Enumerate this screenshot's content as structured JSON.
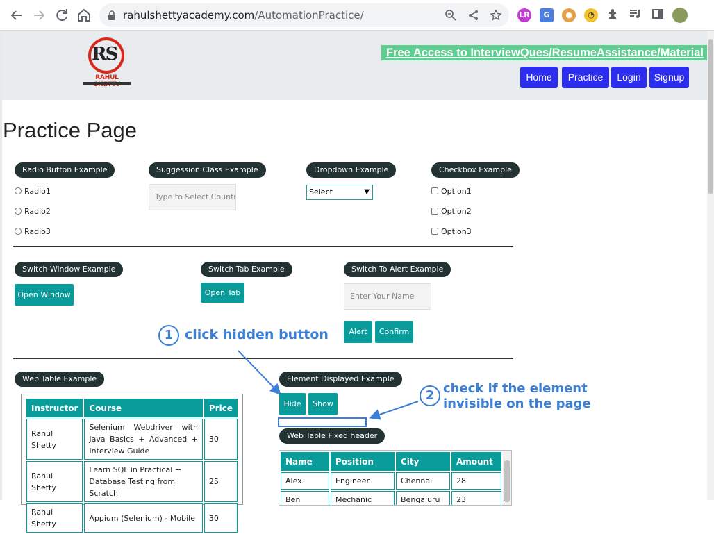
{
  "browser": {
    "url_domain": "rahulshettyacademy.com",
    "url_path": "/AutomationPractice/",
    "icons": [
      "back-icon",
      "forward-icon",
      "reload-icon",
      "home-icon",
      "lock-icon",
      "zoom-icon",
      "share-icon",
      "star-icon",
      "extensions-icon"
    ]
  },
  "header": {
    "logo_initials": "RS",
    "logo_name": "RAHUL SHETTY",
    "free_access_link": "Free Access to InterviewQues/ResumeAssistance/Material",
    "nav": [
      "Home",
      "Practice",
      "Login",
      "Signup"
    ]
  },
  "page_title": "Practice Page",
  "radio": {
    "title": "Radio Button Example",
    "options": [
      "Radio1",
      "Radio2",
      "Radio3"
    ]
  },
  "suggestion": {
    "title": "Suggession Class Example",
    "placeholder": "Type to Select Countr"
  },
  "dropdown": {
    "title": "Dropdown Example",
    "selected": "Select"
  },
  "checkbox": {
    "title": "Checkbox Example",
    "options": [
      "Option1",
      "Option2",
      "Option3"
    ]
  },
  "switch_window": {
    "title": "Switch Window Example",
    "button": "Open Window"
  },
  "switch_tab": {
    "title": "Switch Tab Example",
    "button": "Open Tab"
  },
  "alert": {
    "title": "Switch To Alert Example",
    "placeholder": "Enter Your Name",
    "alert_button": "Alert",
    "confirm_button": "Confirm"
  },
  "annotations": {
    "step1_num": "1",
    "step1_text": "click hidden button",
    "step2_num": "2",
    "step2_line1": "check if the element",
    "step2_line2": "invisible on the page"
  },
  "web_table": {
    "title": "Web Table Example",
    "headers": [
      "Instructor",
      "Course",
      "Price"
    ],
    "rows": [
      [
        "Rahul Shetty",
        "Selenium Webdriver with Java Basics + Advanced + Interview Guide",
        "30"
      ],
      [
        "Rahul Shetty",
        "Learn SQL in Practical + Database Testing from Scratch",
        "25"
      ],
      [
        "Rahul Shetty",
        "Appium (Selenium) - Mobile",
        "30"
      ]
    ]
  },
  "element_displayed": {
    "title": "Element Displayed Example",
    "hide_button": "Hide",
    "show_button": "Show"
  },
  "fixed_table": {
    "title": "Web Table Fixed header",
    "headers": [
      "Name",
      "Position",
      "City",
      "Amount"
    ],
    "rows": [
      [
        "Alex",
        "Engineer",
        "Chennai",
        "28"
      ],
      [
        "Ben",
        "Mechanic",
        "Bengaluru",
        "23"
      ]
    ]
  },
  "colors": {
    "teal": "#0a9b9b",
    "pill": "#233232",
    "nav_blue": "#2d2df0",
    "free_link_green": "#5fcf91",
    "annotation_blue": "#3b7fd6"
  }
}
